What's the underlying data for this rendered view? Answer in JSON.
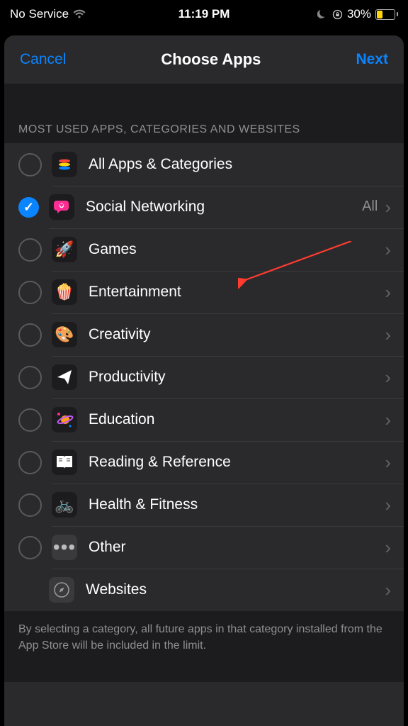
{
  "status": {
    "service": "No Service",
    "time": "11:19 PM",
    "battery_pct": "30%"
  },
  "nav": {
    "cancel": "Cancel",
    "title": "Choose Apps",
    "next": "Next"
  },
  "section_header": "MOST USED APPS, CATEGORIES AND WEBSITES",
  "detail_all": "All",
  "rows": [
    {
      "label": "All Apps & Categories"
    },
    {
      "label": "Social Networking"
    },
    {
      "label": "Games"
    },
    {
      "label": "Entertainment"
    },
    {
      "label": "Creativity"
    },
    {
      "label": "Productivity"
    },
    {
      "label": "Education"
    },
    {
      "label": "Reading & Reference"
    },
    {
      "label": "Health & Fitness"
    },
    {
      "label": "Other"
    },
    {
      "label": "Websites"
    }
  ],
  "footer": "By selecting a category, all future apps in that category installed from the App Store will be included in the limit."
}
